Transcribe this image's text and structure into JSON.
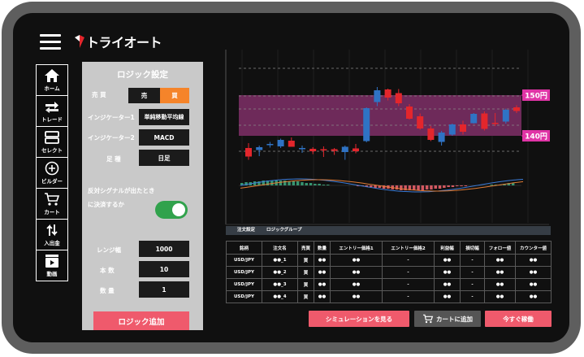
{
  "app": {
    "logo_text": "トライオート"
  },
  "nav": [
    {
      "label": "ホーム",
      "icon": "home-icon"
    },
    {
      "label": "トレード",
      "icon": "trade-arrows-icon"
    },
    {
      "label": "セレクト",
      "icon": "select-icon"
    },
    {
      "label": "ビルダー",
      "icon": "plus-circle-icon"
    },
    {
      "label": "カート",
      "icon": "cart-icon"
    },
    {
      "label": "入出金",
      "icon": "deposit-withdraw-icon"
    },
    {
      "label": "動画",
      "icon": "video-play-icon"
    }
  ],
  "panel": {
    "title": "ロジック設定",
    "side_label": "売 買",
    "sell_label": "売",
    "buy_label": "買",
    "indicator1_label": "インジケーター1",
    "indicator1_value": "単純移動平均線",
    "indicator2_label": "インジケーター2",
    "indicator2_value": "MACD",
    "type_label": "足 種",
    "type_value": "日足",
    "opposite_signal_line1": "反対シグナルが出たとき",
    "opposite_signal_line2": "に決済するか",
    "opposite_signal_on": true,
    "range_label": "レンジ幅",
    "range_value": "1000",
    "count_label": "本 数",
    "count_value": "10",
    "qty_label": "数 量",
    "qty_value": "1",
    "add_button": "ロジック追加"
  },
  "chart_data": {
    "type": "candlestick",
    "y_labels": [
      "150円",
      "140円"
    ],
    "band": {
      "from": 140,
      "to": 150
    },
    "candles": [
      {
        "o": 137.0,
        "h": 138.2,
        "l": 134.1,
        "c": 134.9
      },
      {
        "o": 136.5,
        "h": 137.6,
        "l": 135.0,
        "c": 137.2
      },
      {
        "o": 137.8,
        "h": 138.5,
        "l": 137.1,
        "c": 138.0
      },
      {
        "o": 137.4,
        "h": 139.3,
        "l": 137.0,
        "c": 139.0
      },
      {
        "o": 138.8,
        "h": 139.6,
        "l": 137.5,
        "c": 137.3
      },
      {
        "o": 136.8,
        "h": 137.6,
        "l": 135.8,
        "c": 137.0
      },
      {
        "o": 136.8,
        "h": 137.2,
        "l": 135.5,
        "c": 136.2
      },
      {
        "o": 136.7,
        "h": 137.4,
        "l": 134.8,
        "c": 136.6
      },
      {
        "o": 136.7,
        "h": 137.0,
        "l": 135.3,
        "c": 136.3
      },
      {
        "o": 136.0,
        "h": 137.6,
        "l": 134.1,
        "c": 137.3
      },
      {
        "o": 136.9,
        "h": 138.0,
        "l": 135.7,
        "c": 136.2
      },
      {
        "o": 138.7,
        "h": 147.0,
        "l": 138.4,
        "c": 146.8
      },
      {
        "o": 148.3,
        "h": 152.0,
        "l": 147.3,
        "c": 151.2
      },
      {
        "o": 151.4,
        "h": 151.6,
        "l": 148.7,
        "c": 149.4
      },
      {
        "o": 150.5,
        "h": 151.5,
        "l": 147.3,
        "c": 148.0
      },
      {
        "o": 147.2,
        "h": 147.8,
        "l": 144.0,
        "c": 144.2
      },
      {
        "o": 144.8,
        "h": 145.5,
        "l": 141.5,
        "c": 141.8
      },
      {
        "o": 141.8,
        "h": 142.4,
        "l": 138.7,
        "c": 139.0
      },
      {
        "o": 138.5,
        "h": 141.2,
        "l": 137.6,
        "c": 140.8
      },
      {
        "o": 140.3,
        "h": 143.0,
        "l": 140.0,
        "c": 142.8
      },
      {
        "o": 142.8,
        "h": 143.7,
        "l": 140.3,
        "c": 141.0
      },
      {
        "o": 143.1,
        "h": 145.6,
        "l": 143.0,
        "c": 145.4
      },
      {
        "o": 145.5,
        "h": 146.0,
        "l": 141.3,
        "c": 141.7
      },
      {
        "o": 143.2,
        "h": 145.6,
        "l": 142.4,
        "c": 143.0
      },
      {
        "o": 143.5,
        "h": 146.7,
        "l": 143.0,
        "c": 146.4
      },
      {
        "o": 147.0,
        "h": 147.5,
        "l": 145.6,
        "c": 146.1
      }
    ],
    "colors": {
      "up": "#2f73c4",
      "down": "#e3262c",
      "band": "#6e2a5a",
      "label_bg": "#e034a6"
    }
  },
  "tables": {
    "group_tabs": [
      "注文設定",
      "ロジックグループ"
    ],
    "headers": [
      "銘柄",
      "注文名",
      "売買",
      "数量",
      "エントリー価格1",
      "エントリー価格2",
      "利益幅",
      "損切幅",
      "フォロー値",
      "カウンター値"
    ],
    "rows": [
      [
        "USD/JPY",
        "●●_1",
        "買",
        "●●",
        "●●",
        "-",
        "●●",
        "-",
        "●●",
        "●●"
      ],
      [
        "USD/JPY",
        "●●_2",
        "買",
        "●●",
        "●●",
        "-",
        "●●",
        "-",
        "●●",
        "●●"
      ],
      [
        "USD/JPY",
        "●●_3",
        "買",
        "●●",
        "●●",
        "-",
        "●●",
        "-",
        "●●",
        "●●"
      ],
      [
        "USD/JPY",
        "●●_4",
        "買",
        "●●",
        "●●",
        "-",
        "●●",
        "-",
        "●●",
        "●●"
      ]
    ]
  },
  "actions": {
    "simulate": "シミュレーションを見る",
    "add_cart": "カートに追加",
    "run_now": "今すぐ稼働"
  },
  "colors": {
    "accent_red": "#ef5a6c",
    "accent_orange": "#f5842a",
    "toggle_green": "#31a24c"
  }
}
